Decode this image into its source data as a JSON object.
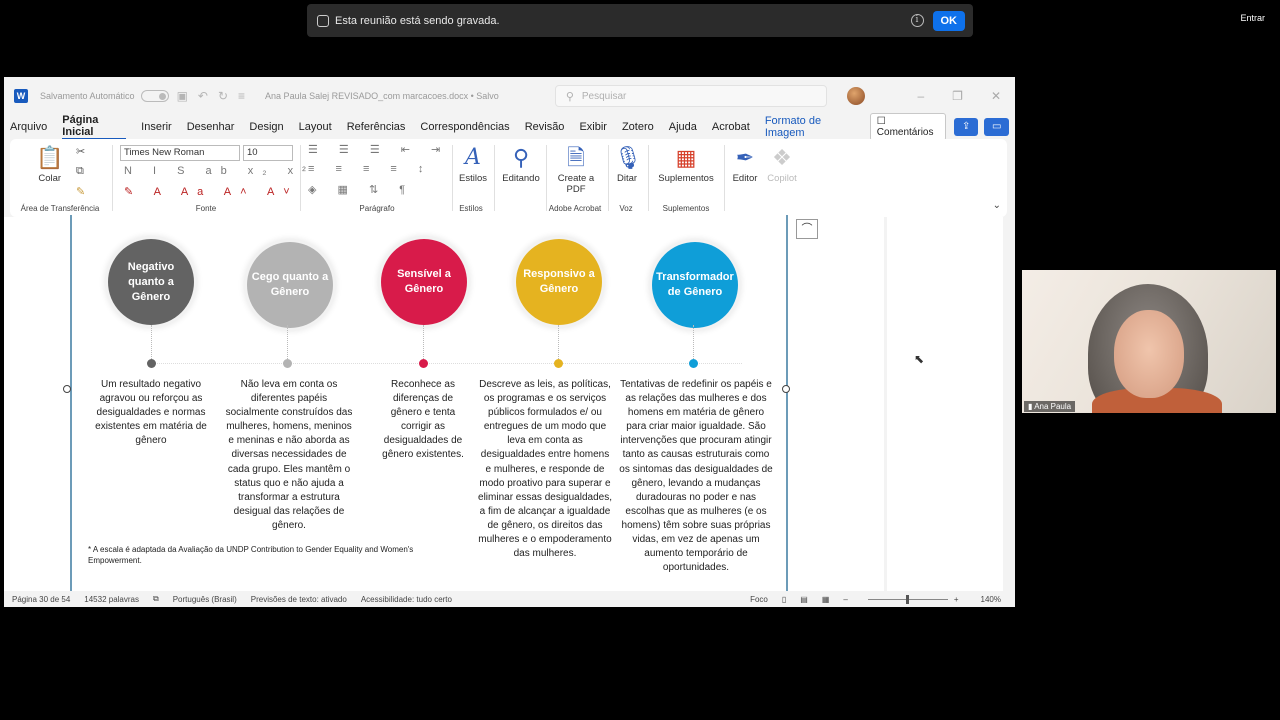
{
  "meeting": {
    "notice": "Esta reunião está sendo gravada.",
    "ok_label": "OK",
    "entrar_label": "Entrar"
  },
  "word": {
    "title": {
      "autosave": "Salvamento Automático",
      "docname": "Ana Paula Salej REVISADO_com marcacoes.docx • Salvo",
      "search_placeholder": "Pesquisar"
    },
    "menu": [
      "Arquivo",
      "Página Inicial",
      "Inserir",
      "Desenhar",
      "Design",
      "Layout",
      "Referências",
      "Correspondências",
      "Revisão",
      "Exibir",
      "Zotero",
      "Ajuda",
      "Acrobat",
      "Formato de Imagem"
    ],
    "comentarios": "Comentários",
    "ribbon": {
      "colar": "Colar",
      "area_transferencia": "Área de Transferência",
      "font_name": "Times New Roman",
      "font_size": "10",
      "fonte": "Fonte",
      "paragrafo": "Parágrafo",
      "estilos": "Estilos",
      "estilos_group": "Estilos",
      "editando": "Editando",
      "create_pdf": "Create a PDF",
      "adobe_acrobat": "Adobe Acrobat",
      "ditar": "Ditar",
      "voz": "Voz",
      "suplementos": "Suplementos",
      "suplementos_group": "Suplementos",
      "editor": "Editor",
      "copilot": "Copilot"
    },
    "figure": {
      "circles": [
        {
          "label": "Negativo quanto a Gênero",
          "color": "#636363"
        },
        {
          "label": "Cego quanto a Gênero",
          "color": "#b3b3b3"
        },
        {
          "label": "Sensível a Gênero",
          "color": "#d81b4a"
        },
        {
          "label": "Responsivo a Gênero",
          "color": "#e5b320"
        },
        {
          "label": "Transformador de Gênero",
          "color": "#0f9ed8"
        }
      ],
      "descriptions": [
        "Um resultado negativo agravou ou reforçou as desigualdades e normas existentes em matéria de gênero",
        "Não leva em conta os diferentes papéis socialmente construídos das mulheres, homens, meninos e meninas e não aborda as diversas necessidades de cada grupo. Eles mantêm o status quo e não ajuda a transformar a estrutura desigual das relações de gênero.",
        "Reconhece as diferenças de gênero e tenta corrigir as desigualdades de gênero existentes.",
        "Descreve as leis, as políticas, os programas e os serviços públicos formulados e/ ou entregues de um modo que leva em conta as desigualdades entre homens e mulheres, e responde de modo proativo para superar e eliminar essas desigualdades, a fim de alcançar a igualdade de gênero, os direitos das mulheres e o empoderamento das mulheres.",
        "Tentativas de redefinir os papéis e as relações das mulheres e dos homens em matéria de gênero para criar maior igualdade. São intervenções que procuram atingir tanto as causas estruturais como os sintomas das desigualdades de gênero, levando a mudanças duradouras no poder e nas escolhas que as mulheres (e os homens) têm sobre suas próprias vidas, em vez de apenas um aumento temporário de oportunidades."
      ],
      "footnote": "* A escala é adaptada da Avaliação da UNDP Contribution to Gender Equality and Women's Empowerment."
    },
    "status": {
      "page": "Página 30 de 54",
      "words": "14532 palavras",
      "language": "Português (Brasil)",
      "predictions": "Previsões de texto: ativado",
      "accessibility": "Acessibilidade: tudo certo",
      "focus": "Foco",
      "zoom": "140%"
    }
  },
  "video": {
    "participant": "Ana Paula"
  }
}
